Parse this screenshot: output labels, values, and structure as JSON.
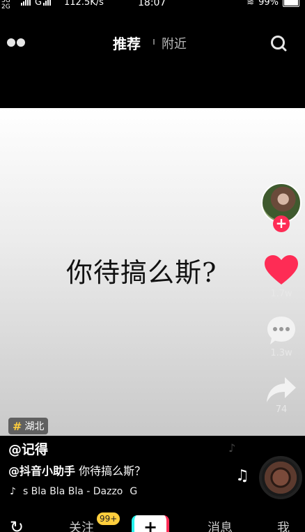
{
  "status_bar": {
    "network_top": "3G",
    "network_bottom": "2G",
    "network_g": "G",
    "speed": "112.5K/s",
    "time": "18:07",
    "battery": "99%"
  },
  "top_nav": {
    "tab_recommended": "推荐",
    "tab_nearby": "附近"
  },
  "video": {
    "caption": "你待搞么斯?"
  },
  "actions": {
    "like_count": "1.7w",
    "comment_count": "1.3w",
    "share_count": "74"
  },
  "post": {
    "location": "湖北",
    "username": "@记得",
    "mention": "@抖音小助手",
    "description": "你待搞么斯？",
    "music": "s Bla Bla Bla - Dazzo",
    "music_tail": "G"
  },
  "tab_bar": {
    "follow_label": "关注",
    "follow_badge": "99+",
    "create_label": "+",
    "messages_label": "消息",
    "me_label": "我"
  },
  "colors": {
    "accent_red": "#fe2c55",
    "accent_cyan": "#25f4ee",
    "badge_yellow": "#ffce3d"
  }
}
